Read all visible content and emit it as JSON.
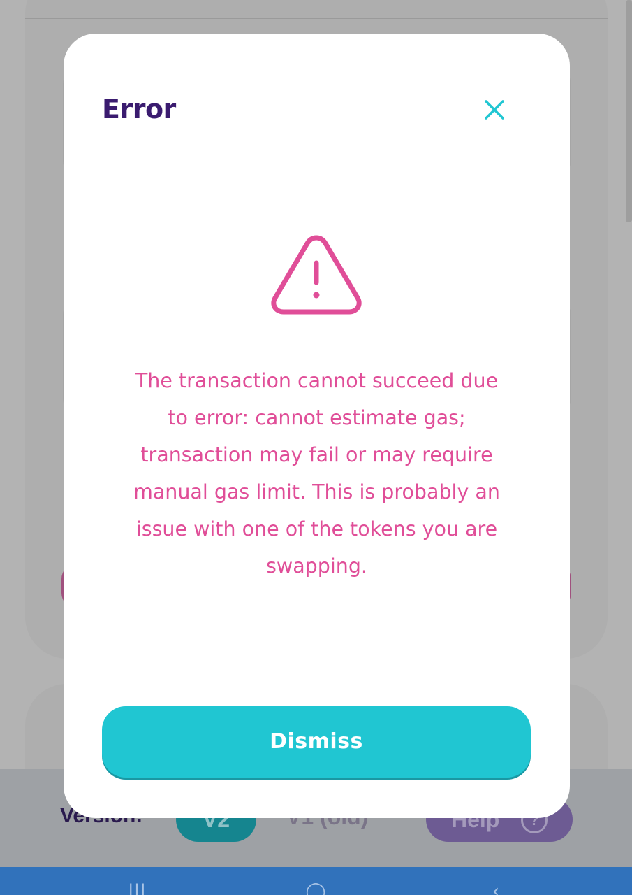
{
  "modal": {
    "title": "Error",
    "message": "The transaction cannot succeed due to error: cannot estimate gas; transaction may fail or may require manual gas limit. This is probably an issue with one of the tokens you are swapping.",
    "dismiss_label": "Dismiss",
    "close_icon": "close-icon",
    "warning_icon": "warning-triangle-icon"
  },
  "footer": {
    "version_label": "Version:",
    "v2_label": "V2",
    "v1_label": "V1 (old)",
    "help_label": "Help",
    "help_icon_glyph": "?"
  },
  "colors": {
    "title": "#3a1b6f",
    "accent_teal": "#20c6d2",
    "error_pink": "#e04e98",
    "close_icon": "#20c6d2",
    "nav_bar": "#3172bb"
  }
}
